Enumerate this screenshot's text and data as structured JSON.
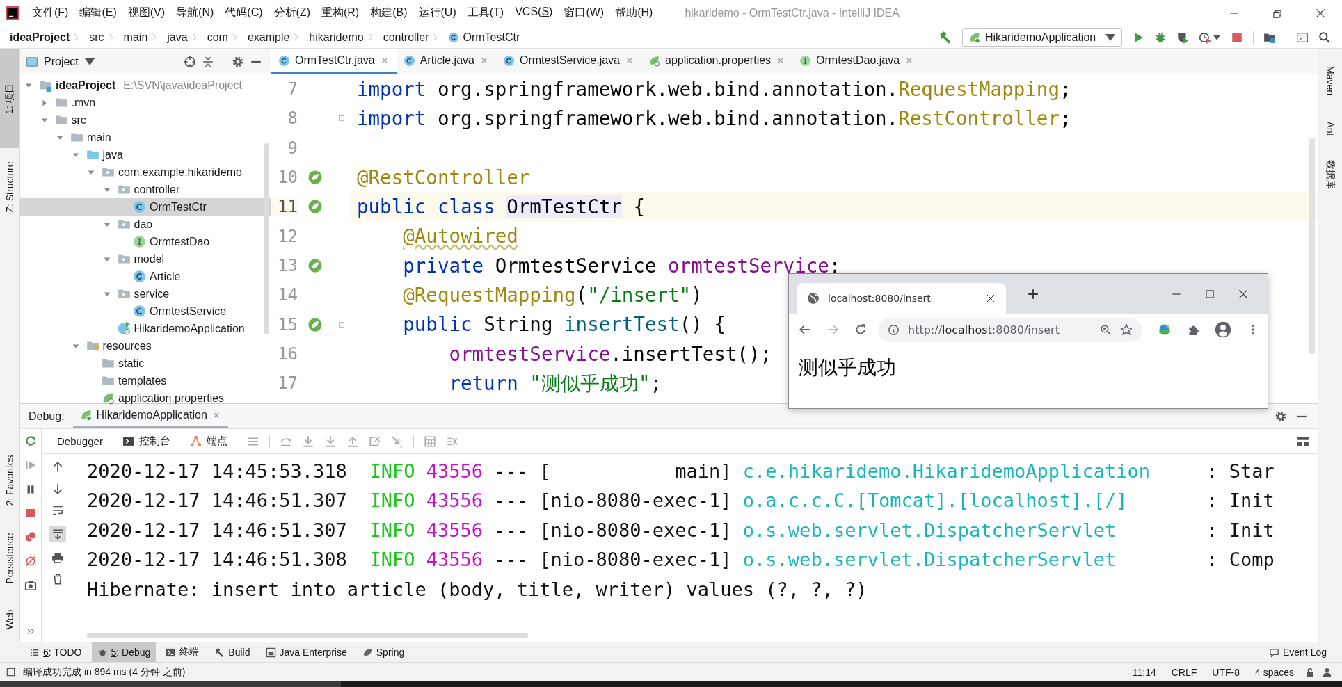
{
  "window": {
    "title": "hikaridemo - OrmTestCtr.java - IntelliJ IDEA"
  },
  "menu": [
    {
      "before": "文件(",
      "key": "F",
      "after": ")"
    },
    {
      "before": "编辑(",
      "key": "E",
      "after": ")"
    },
    {
      "before": "视图(",
      "key": "V",
      "after": ")"
    },
    {
      "before": "导航(",
      "key": "N",
      "after": ")"
    },
    {
      "before": "代码(",
      "key": "C",
      "after": ")"
    },
    {
      "before": "分析(",
      "key": "Z",
      "after": ")"
    },
    {
      "before": "重构(",
      "key": "R",
      "after": ")"
    },
    {
      "before": "构建(",
      "key": "B",
      "after": ")"
    },
    {
      "before": "运行(",
      "key": "U",
      "after": ")"
    },
    {
      "before": "工具(",
      "key": "T",
      "after": ")"
    },
    {
      "before": "VCS(",
      "key": "S",
      "after": ")"
    },
    {
      "before": "窗口(",
      "key": "W",
      "after": ")"
    },
    {
      "before": "帮助(",
      "key": "H",
      "after": ")"
    }
  ],
  "breadcrumbs": [
    {
      "label": "ideaProject",
      "kind": "project"
    },
    {
      "label": "src",
      "kind": "folder"
    },
    {
      "label": "main",
      "kind": "folder"
    },
    {
      "label": "java",
      "kind": "folder"
    },
    {
      "label": "com",
      "kind": "folder"
    },
    {
      "label": "example",
      "kind": "folder"
    },
    {
      "label": "hikaridemo",
      "kind": "folder"
    },
    {
      "label": "controller",
      "kind": "folder"
    },
    {
      "label": "OrmTestCtr",
      "kind": "class"
    }
  ],
  "run_configuration": {
    "label": "HikaridemoApplication"
  },
  "left_tool_windows": [
    {
      "label": "1: 项目",
      "selected": true
    },
    {
      "label": "Z: Structure",
      "selected": false
    }
  ],
  "left_tool_windows_bottom": [
    {
      "label": "2: Favorites",
      "selected": false
    },
    {
      "label": "Persistence",
      "selected": false
    },
    {
      "label": "Web",
      "selected": false
    }
  ],
  "right_tool_windows": [
    {
      "label": "Maven"
    },
    {
      "label": "Ant"
    },
    {
      "label": "数据库"
    }
  ],
  "project_panel": {
    "title": "Project",
    "tree": [
      {
        "label": "ideaProject",
        "detail": "E:\\SVN\\java\\ideaProject",
        "kind": "project",
        "expanded": true,
        "selected": false,
        "children": [
          {
            "label": ".mvn",
            "kind": "folder",
            "expanded": false,
            "selected": false
          },
          {
            "label": "src",
            "kind": "folder",
            "expanded": true,
            "selected": false,
            "children": [
              {
                "label": "main",
                "kind": "folder",
                "expanded": true,
                "selected": false,
                "children": [
                  {
                    "label": "java",
                    "kind": "source-folder",
                    "expanded": true,
                    "selected": false,
                    "children": [
                      {
                        "label": "com.example.hikaridemo",
                        "kind": "package",
                        "expanded": true,
                        "selected": false,
                        "children": [
                          {
                            "label": "controller",
                            "kind": "package",
                            "expanded": true,
                            "selected": false,
                            "children": [
                              {
                                "label": "OrmTestCtr",
                                "kind": "class",
                                "selected": true
                              }
                            ]
                          },
                          {
                            "label": "dao",
                            "kind": "package",
                            "expanded": true,
                            "selected": false,
                            "children": [
                              {
                                "label": "OrmtestDao",
                                "kind": "interface",
                                "selected": false
                              }
                            ]
                          },
                          {
                            "label": "model",
                            "kind": "package",
                            "expanded": true,
                            "selected": false,
                            "children": [
                              {
                                "label": "Article",
                                "kind": "class",
                                "selected": false
                              }
                            ]
                          },
                          {
                            "label": "service",
                            "kind": "package",
                            "expanded": true,
                            "selected": false,
                            "children": [
                              {
                                "label": "OrmtestService",
                                "kind": "class",
                                "selected": false
                              }
                            ]
                          },
                          {
                            "label": "HikaridemoApplication",
                            "kind": "spring-class",
                            "selected": false
                          }
                        ]
                      }
                    ]
                  },
                  {
                    "label": "resources",
                    "kind": "resources-folder",
                    "expanded": true,
                    "selected": false,
                    "children": [
                      {
                        "label": "static",
                        "kind": "folder",
                        "selected": false
                      },
                      {
                        "label": "templates",
                        "kind": "folder",
                        "selected": false
                      },
                      {
                        "label": "application.properties",
                        "kind": "properties",
                        "selected": false
                      }
                    ]
                  }
                ]
              }
            ]
          }
        ]
      }
    ]
  },
  "editor_tabs": [
    {
      "label": "OrmTestCtr.java",
      "kind": "class",
      "selected": true
    },
    {
      "label": "Article.java",
      "kind": "class",
      "selected": false
    },
    {
      "label": "OrmtestService.java",
      "kind": "class",
      "selected": false
    },
    {
      "label": "application.properties",
      "kind": "properties",
      "selected": false
    },
    {
      "label": "OrmtestDao.java",
      "kind": "interface",
      "selected": false
    }
  ],
  "code": [
    {
      "number": "7",
      "current": false,
      "gutter_marker": false,
      "fold": false,
      "segments": [
        {
          "kind": "keyword",
          "text": "import "
        },
        {
          "kind": "plain",
          "text": "org.springframework.web.bind.annotation."
        },
        {
          "kind": "annotation",
          "text": "RequestMapping"
        },
        {
          "kind": "plain",
          "text": ";"
        }
      ]
    },
    {
      "number": "8",
      "current": false,
      "gutter_marker": false,
      "fold": true,
      "segments": [
        {
          "kind": "keyword",
          "text": "import "
        },
        {
          "kind": "plain",
          "text": "org.springframework.web.bind.annotation."
        },
        {
          "kind": "annotation",
          "text": "RestController"
        },
        {
          "kind": "plain",
          "text": ";"
        }
      ]
    },
    {
      "number": "9",
      "current": false,
      "gutter_marker": false,
      "fold": false
    },
    {
      "number": "10",
      "current": false,
      "gutter_marker": true,
      "fold": false,
      "segments": [
        {
          "kind": "annotation",
          "text": "@RestController"
        }
      ]
    },
    {
      "number": "11",
      "current": true,
      "gutter_marker": true,
      "fold": false,
      "segments": [
        {
          "kind": "keyword",
          "text": "public class "
        },
        {
          "kind": "usage",
          "text": "OrmTestCtr"
        },
        {
          "kind": "plain",
          "text": " {"
        }
      ]
    },
    {
      "number": "12",
      "current": false,
      "gutter_marker": false,
      "fold": false,
      "segments": [
        {
          "kind": "annotation-warning",
          "text": "    @Autowired"
        }
      ]
    },
    {
      "number": "13",
      "current": false,
      "gutter_marker": true,
      "fold": false,
      "segments": [
        {
          "kind": "keyword",
          "text": "    private "
        },
        {
          "kind": "plain",
          "text": "OrmtestService "
        },
        {
          "kind": "field",
          "text": "ormtestService"
        },
        {
          "kind": "plain",
          "text": ";"
        }
      ]
    },
    {
      "number": "14",
      "current": false,
      "gutter_marker": false,
      "fold": false,
      "segments": [
        {
          "kind": "annotation",
          "text": "    @RequestMapping"
        },
        {
          "kind": "plain",
          "text": "("
        },
        {
          "kind": "string",
          "text": "\"/insert\""
        },
        {
          "kind": "plain",
          "text": ")"
        }
      ]
    },
    {
      "number": "15",
      "current": false,
      "gutter_marker": true,
      "fold": true,
      "segments": [
        {
          "kind": "keyword",
          "text": "    public "
        },
        {
          "kind": "plain",
          "text": "String "
        },
        {
          "kind": "method",
          "text": "insertTest"
        },
        {
          "kind": "plain",
          "text": "() {"
        }
      ]
    },
    {
      "number": "16",
      "current": false,
      "gutter_marker": false,
      "fold": false,
      "segments": [
        {
          "kind": "field",
          "text": "        ormtestService"
        },
        {
          "kind": "plain",
          "text": ".insertTest();"
        }
      ]
    },
    {
      "number": "17",
      "current": false,
      "gutter_marker": false,
      "fold": false,
      "segments": [
        {
          "kind": "keyword",
          "text": "        return "
        },
        {
          "kind": "string",
          "text": "\"测似乎成功\""
        },
        {
          "kind": "plain",
          "text": ";"
        }
      ]
    }
  ],
  "debug_panel": {
    "label": "Debug:",
    "session": "HikaridemoApplication",
    "tabs": [
      {
        "label": "Debugger",
        "kind": "debugger"
      },
      {
        "label": "控制台",
        "kind": "console"
      },
      {
        "label": "端点",
        "kind": "endpoints"
      }
    ]
  },
  "console": [
    [
      {
        "kind": "plain",
        "text": "2020-12-17 14:45:53.318  "
      },
      {
        "kind": "level",
        "text": "INFO"
      },
      {
        "kind": "pid",
        "text": " 43556"
      },
      {
        "kind": "plain",
        "text": " --- [           main] "
      },
      {
        "kind": "logger",
        "text": "c.e.hikaridemo.HikaridemoApplication    "
      },
      {
        "kind": "plain",
        "text": " : Star"
      }
    ],
    [
      {
        "kind": "plain",
        "text": "2020-12-17 14:46:51.307  "
      },
      {
        "kind": "level",
        "text": "INFO"
      },
      {
        "kind": "pid",
        "text": " 43556"
      },
      {
        "kind": "plain",
        "text": " --- [nio-8080-exec-1] "
      },
      {
        "kind": "logger",
        "text": "o.a.c.c.C.[Tomcat].[localhost].[/]      "
      },
      {
        "kind": "plain",
        "text": " : Init"
      }
    ],
    [
      {
        "kind": "plain",
        "text": "2020-12-17 14:46:51.307  "
      },
      {
        "kind": "level",
        "text": "INFO"
      },
      {
        "kind": "pid",
        "text": " 43556"
      },
      {
        "kind": "plain",
        "text": " --- [nio-8080-exec-1] "
      },
      {
        "kind": "logger",
        "text": "o.s.web.servlet.DispatcherServlet       "
      },
      {
        "kind": "plain",
        "text": " : Init"
      }
    ],
    [
      {
        "kind": "plain",
        "text": "2020-12-17 14:46:51.308  "
      },
      {
        "kind": "level",
        "text": "INFO"
      },
      {
        "kind": "pid",
        "text": " 43556"
      },
      {
        "kind": "plain",
        "text": " --- [nio-8080-exec-1] "
      },
      {
        "kind": "logger",
        "text": "o.s.web.servlet.DispatcherServlet       "
      },
      {
        "kind": "plain",
        "text": " : Comp"
      }
    ],
    [
      {
        "kind": "plain",
        "text": "Hibernate: insert into article (body, title, writer) values (?, ?, ?)"
      }
    ]
  ],
  "bottom_tools": [
    {
      "key": "6",
      "label": ": TODO",
      "kind": "todo",
      "selected": false
    },
    {
      "key": "5",
      "label": ": Debug",
      "kind": "debug",
      "selected": true
    },
    {
      "label": "终端",
      "kind": "terminal",
      "selected": false
    },
    {
      "label": "Build",
      "kind": "build",
      "selected": false
    },
    {
      "label": "Java Enterprise",
      "kind": "enterprise",
      "selected": false
    },
    {
      "label": "Spring",
      "kind": "spring",
      "selected": false
    }
  ],
  "event_log": "Event Log",
  "status_bar": {
    "message": "编译成功完成 in 894 ms (4 分钟 之前)",
    "items": [
      "11:14",
      "CRLF",
      "UTF-8",
      "4 spaces"
    ]
  },
  "browser": {
    "tab_title": "localhost:8080/insert",
    "url": [
      {
        "text": "http://",
        "strong": false
      },
      {
        "text": "localhost",
        "strong": true
      },
      {
        "text": ":8080/insert",
        "strong": false
      }
    ],
    "body": "测似乎成功"
  }
}
